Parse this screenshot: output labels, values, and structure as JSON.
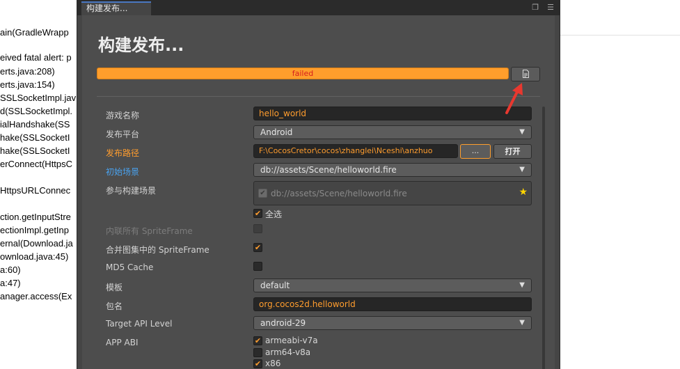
{
  "background_log": [
    "ain(GradleWrapp",
    "eived fatal alert: p",
    "erts.java:208)",
    "erts.java:154)",
    "SSLSocketImpl.jav",
    "d(SSLSocketImpl.",
    "ialHandshake(SS",
    "hake(SSLSocketI",
    "hake(SSLSocketI",
    "erConnect(HttpsC",
    "HttpsURLConnec",
    "ction.getInputStre",
    "ectionImpl.getInp",
    "ernal(Download.ja",
    "ownload.java:45)",
    "a:60)",
    "a:47)",
    "anager.access(Ex"
  ],
  "window": {
    "tab_label": "构建发布...",
    "tab_icons": [
      "restore-icon",
      "menu-icon"
    ],
    "title": "构建发布...",
    "progress": {
      "status_text": "failed",
      "value": 1.0,
      "color": "#ff9e2c"
    },
    "log_button_icon": "document-icon"
  },
  "form": {
    "game_name": {
      "label": "游戏名称",
      "value": "hello_world"
    },
    "platform": {
      "label": "发布平台",
      "value": "Android"
    },
    "build_path": {
      "label": "发布路径",
      "value": "F:\\CocosCretor\\cocos\\zhanglei\\Nceshi\\anzhuo",
      "browse_label": "...",
      "open_label": "打开"
    },
    "start_scene": {
      "label": "初始场景",
      "value": "db://assets/Scene/helloworld.fire"
    },
    "included_scenes": {
      "label": "参与构建场景",
      "scene": "db://assets/Scene/helloworld.fire",
      "select_all_label": "全选"
    },
    "inline_spriteframe": {
      "label": "内联所有 SpriteFrame",
      "checked": false
    },
    "merge_spriteframe": {
      "label": "合并图集中的 SpriteFrame",
      "checked": true
    },
    "md5_cache": {
      "label": "MD5 Cache",
      "checked": false
    },
    "template": {
      "label": "模板",
      "value": "default"
    },
    "package_name": {
      "label": "包名",
      "value": "org.cocos2d.helloworld"
    },
    "target_api": {
      "label": "Target API Level",
      "value": "android-29"
    },
    "app_abi": {
      "label": "APP ABI",
      "options": [
        {
          "label": "armeabi-v7a",
          "checked": true
        },
        {
          "label": "arm64-v8a",
          "checked": false
        },
        {
          "label": "x86",
          "checked": true
        }
      ]
    }
  },
  "colors": {
    "accent_orange": "#ff9d2e",
    "link_blue": "#4aa3f0",
    "error_red": "#d61e1e",
    "annotation_red": "#e8382f"
  }
}
